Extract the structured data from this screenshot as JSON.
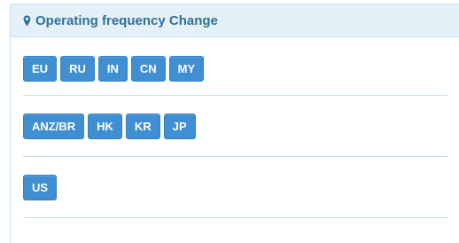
{
  "panel": {
    "title": "Operating frequency Change",
    "icon": "map-marker-icon"
  },
  "regions": [
    [
      "EU",
      "RU",
      "IN",
      "CN",
      "MY"
    ],
    [
      "ANZ/BR",
      "HK",
      "KR",
      "JP"
    ],
    [
      "US"
    ]
  ],
  "colors": {
    "header_bg": "#e4f1f8",
    "header_text": "#2f6f9a",
    "button_bg": "#3f8fd2",
    "divider": "#bfe0ea"
  }
}
